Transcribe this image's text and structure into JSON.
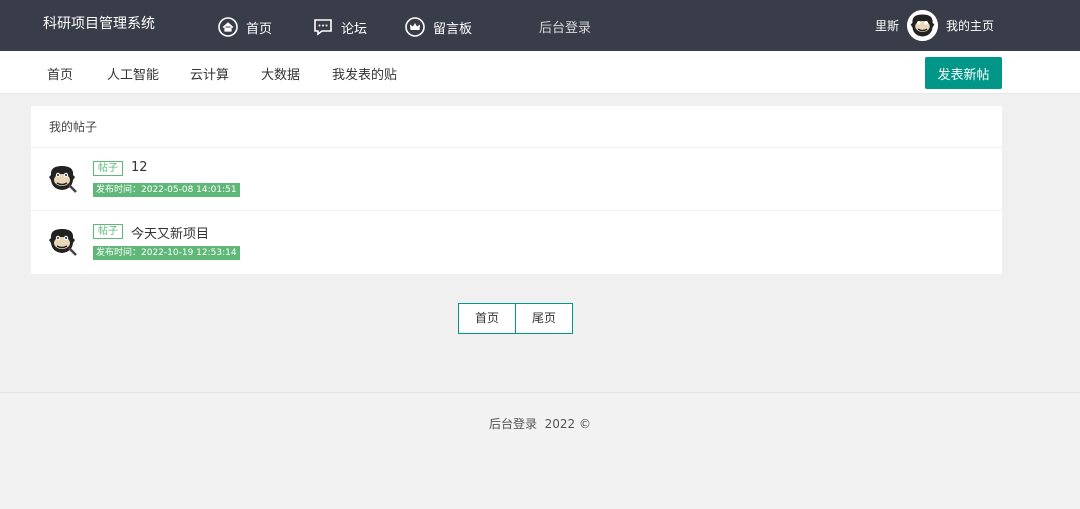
{
  "header": {
    "brand": "科研项目管理系统",
    "nav": [
      {
        "label": "首页",
        "icon": "home-icon"
      },
      {
        "label": "论坛",
        "icon": "chat-icon"
      },
      {
        "label": "留言板",
        "icon": "crown-icon"
      },
      {
        "label": "后台登录"
      }
    ],
    "user": {
      "name": "里斯",
      "home_link": "我的主页",
      "avatar_icon": "monkey-avatar-icon"
    }
  },
  "subnav": {
    "items": [
      "首页",
      "人工智能",
      "云计算",
      "大数据",
      "我发表的贴"
    ],
    "post_button": "发表新帖"
  },
  "posts_panel": {
    "title": "我的帖子",
    "posts": [
      {
        "tag": "帖子",
        "title": "12",
        "time": "发布时间：2022-05-08 14:01:51"
      },
      {
        "tag": "帖子",
        "title": "今天又新项目",
        "time": "发布时间：2022-10-19 12:53:14"
      }
    ]
  },
  "pagination": {
    "first": "首页",
    "last": "尾页"
  },
  "footer": {
    "text": "后台登录  2022 ©"
  },
  "colors": {
    "topbar": "#393d49",
    "accent": "#009688",
    "tag_green": "#5fb878"
  }
}
